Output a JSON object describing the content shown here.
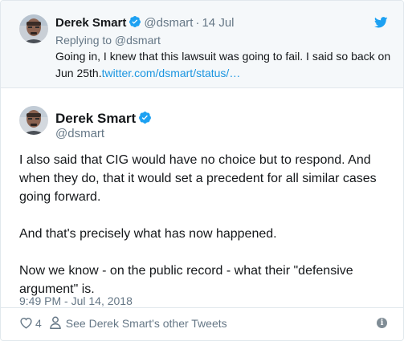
{
  "parent_tweet": {
    "author_name": "Derek Smart",
    "author_handle": "@dsmart",
    "separator": "·",
    "date": "14 Jul",
    "replying_to": "Replying to @dsmart",
    "text": "Going in, I knew that this lawsuit was going to fail. I said so back on Jun 25th.",
    "link_text": "twitter.com/dsmart/status/…"
  },
  "main_tweet": {
    "author_name": "Derek Smart",
    "author_handle": "@dsmart",
    "paragraphs": [
      "I also said that CIG would have no choice but to respond. And when they do, that it would set a precedent for all similar cases going forward.",
      "And that's precisely what has now happened.",
      "Now we know - on the public record - what their \"defensive argument\" is."
    ],
    "timestamp": "9:49 PM - Jul 14, 2018",
    "like_count": "4",
    "other_tweets_label": "See Derek Smart's other Tweets",
    "info_glyph": "i"
  },
  "icons": {
    "logo": "twitter-bird-icon",
    "verified": "verified-badge-icon",
    "like": "heart-icon",
    "profile": "person-icon",
    "info": "info-icon"
  },
  "colors": {
    "brand_blue": "#1da1f2",
    "link": "#1b95e0",
    "muted_text": "#657786",
    "reply_background": "#f5f8fa"
  }
}
